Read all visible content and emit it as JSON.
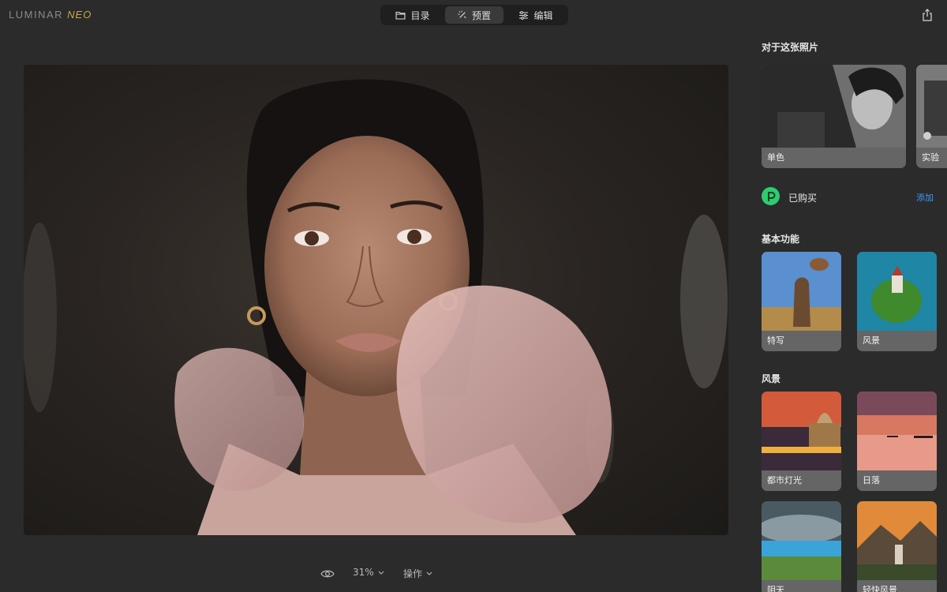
{
  "app": {
    "logo_primary": "LUMINAR",
    "logo_secondary": "NEO"
  },
  "nav": {
    "tabs": [
      {
        "label": "目录",
        "icon": "folder-icon",
        "active": false
      },
      {
        "label": "预置",
        "icon": "magic-wand-icon",
        "active": true
      },
      {
        "label": "编辑",
        "icon": "sliders-icon",
        "active": false
      }
    ]
  },
  "canvas": {
    "zoom": "31%",
    "actions_label": "操作"
  },
  "panel": {
    "about_title": "对于这张照片",
    "about_cards": [
      {
        "label": "单色"
      },
      {
        "label": "实验"
      }
    ],
    "purchased_label": "已购买",
    "add_label": "添加",
    "basics_title": "基本功能",
    "basics_cards": [
      {
        "label": "特写"
      },
      {
        "label": "风景"
      }
    ],
    "landscape_title": "风景",
    "landscape_cards": [
      {
        "label": "都市灯光"
      },
      {
        "label": "日落"
      },
      {
        "label": "阴天"
      },
      {
        "label": "轻快风景"
      }
    ]
  },
  "colors": {
    "accent_link": "#3b9cff",
    "purchased_badge": "#2ecc71",
    "background": "#2b2b2b"
  }
}
